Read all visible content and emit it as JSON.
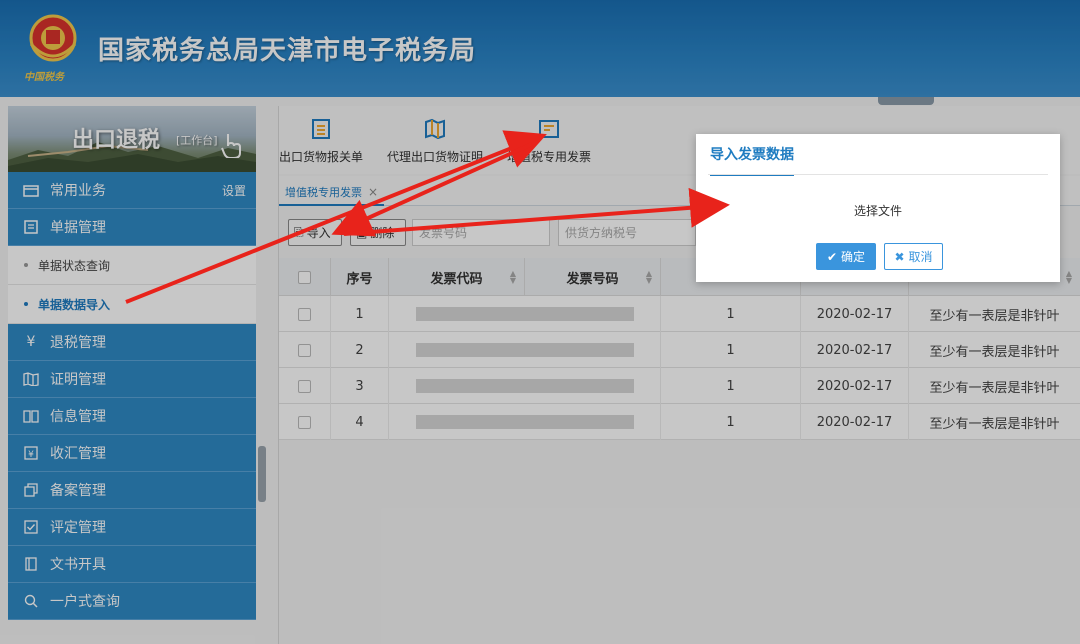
{
  "header": {
    "title": "国家税务总局天津市电子税务局",
    "emblem_icon": "tax-emblem-icon",
    "emblem_caption": "中国税务"
  },
  "sidebar": {
    "banner_title": "出口退税",
    "banner_sub": "[工作台]",
    "items": [
      {
        "label": "常用业务",
        "icon": "folder-icon",
        "right": "设置"
      },
      {
        "label": "单据管理",
        "icon": "document-icon"
      },
      {
        "label": "退税管理",
        "icon": "yuan-icon"
      },
      {
        "label": "证明管理",
        "icon": "map-icon"
      },
      {
        "label": "信息管理",
        "icon": "book-icon"
      },
      {
        "label": "收汇管理",
        "icon": "yuan-box-icon"
      },
      {
        "label": "备案管理",
        "icon": "copy-icon"
      },
      {
        "label": "评定管理",
        "icon": "check-box-icon"
      },
      {
        "label": "文书开具",
        "icon": "file-icon"
      },
      {
        "label": "一户式查询",
        "icon": "search-icon"
      }
    ],
    "sub_items": [
      {
        "label": "单据状态查询",
        "active": false
      },
      {
        "label": "单据数据导入",
        "active": true
      }
    ]
  },
  "toolbar": {
    "items": [
      {
        "label": "出口货物报关单",
        "icon": "list-icon"
      },
      {
        "label": "代理出口货物证明",
        "icon": "map-icon"
      },
      {
        "label": "增值税专用发票",
        "icon": "invoice-icon"
      }
    ]
  },
  "tabs": [
    {
      "label": "增值税专用发票",
      "closable": true
    }
  ],
  "actions": {
    "import_label": "导入",
    "delete_label": "删除",
    "invoice_no_placeholder": "发票号码",
    "supplier_tax_placeholder": "供货方纳税号"
  },
  "table": {
    "headers": [
      "序号",
      "发票代码",
      "发票号码"
    ],
    "rows": [
      {
        "index": "1",
        "qty": "1",
        "date": "2020-02-17",
        "name": "至少有一表层是非针叶"
      },
      {
        "index": "2",
        "qty": "1",
        "date": "2020-02-17",
        "name": "至少有一表层是非针叶"
      },
      {
        "index": "3",
        "qty": "1",
        "date": "2020-02-17",
        "name": "至少有一表层是非针叶"
      },
      {
        "index": "4",
        "qty": "1",
        "date": "2020-02-17",
        "name": "至少有一表层是非针叶"
      }
    ]
  },
  "dialog": {
    "title": "导入发票数据",
    "body": "选择文件",
    "ok_label": "确定",
    "cancel_label": "取消"
  },
  "colors": {
    "header_blue": "#2a84c6",
    "nav_blue": "#2f89c5",
    "accent": "#1f7cc1",
    "arrow_red": "#e8231b"
  }
}
